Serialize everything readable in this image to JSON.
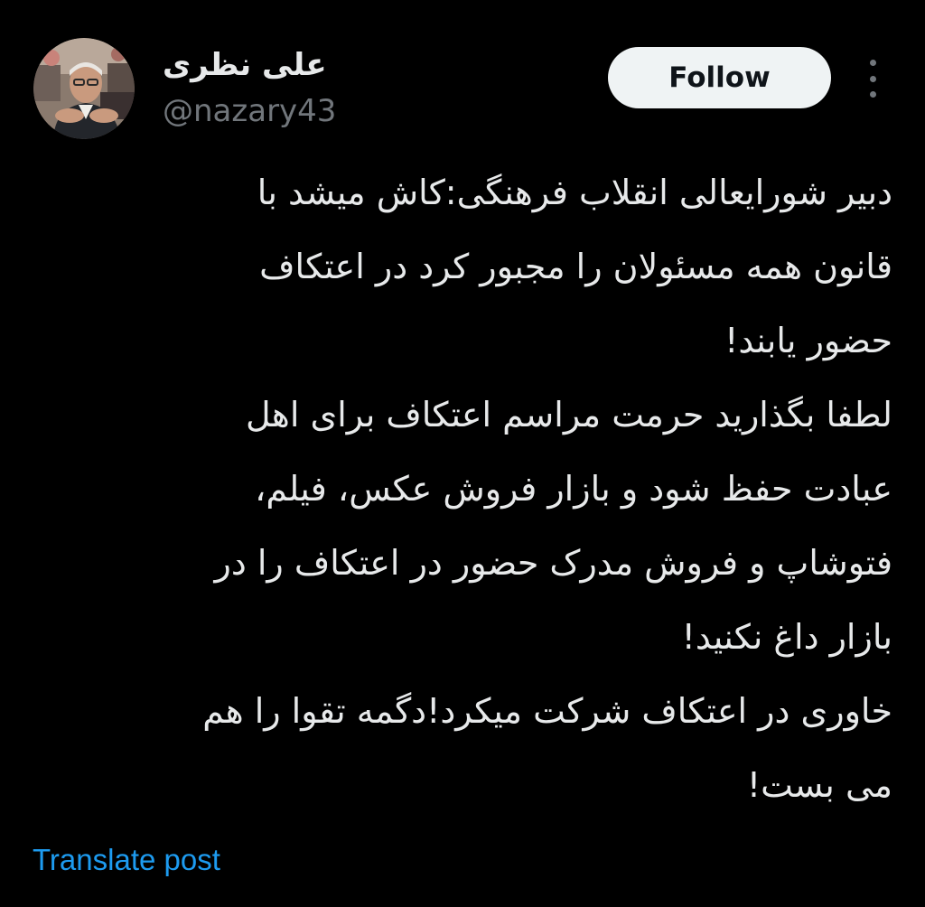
{
  "author": {
    "display_name": "علی نظری",
    "handle": "@nazary43",
    "avatar": "profile-photo"
  },
  "header": {
    "follow_label": "Follow",
    "more_icon": "more-dots-vertical-icon"
  },
  "tweet": {
    "lines": [
      "دبیر شورایعالی انقلاب فرهنگی:کاش میشد با",
      "قانون همه مسئولان را مجبور کرد در اعتکاف",
      "حضور یابند!",
      "لطفا بگذارید حرمت مراسم اعتکاف برای اهل",
      "عبادت حفظ شود و بازار فروش عکس، فیلم،",
      "فتوشاپ و فروش مدرک  حضور در اعتکاف را در",
      "بازار داغ نکنید!",
      "خاوری در اعتکاف شرکت میکرد!دگمه تقوا را هم",
      "می بست!"
    ]
  },
  "footer": {
    "translate_label": "Translate post"
  },
  "colors": {
    "background": "#000000",
    "text_primary": "#e7e9ea",
    "text_secondary": "#71767b",
    "link": "#1d9bf0",
    "follow_bg": "#eff3f4",
    "follow_text": "#0f1419"
  }
}
